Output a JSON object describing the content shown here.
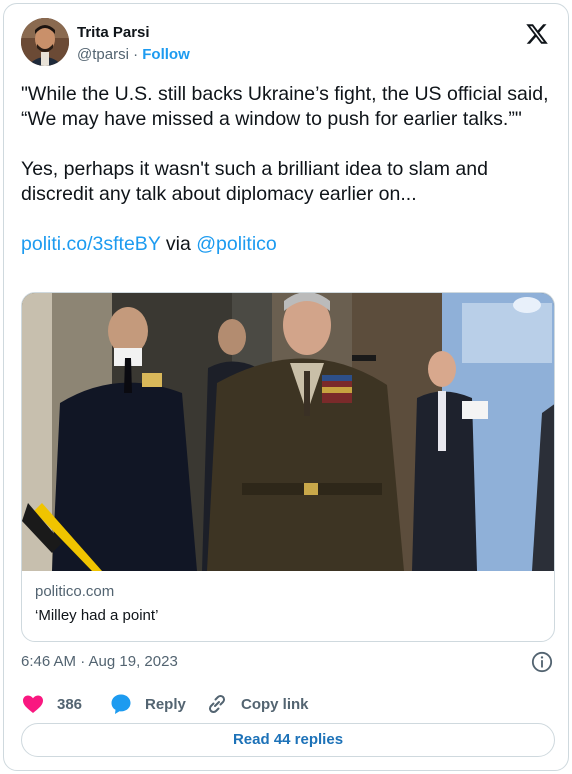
{
  "author": {
    "name": "Trita Parsi",
    "handle": "@tparsi",
    "separator": "·",
    "follow_label": "Follow"
  },
  "brand_icon": "x-logo-icon",
  "tweet": {
    "paragraph_1": "\"While the U.S. still backs Ukraine’s fight, the US official said, “We may have missed a window to push for earlier talks.”\"",
    "paragraph_2": "Yes, perhaps it wasn't such a brilliant idea to slam and discredit any talk about diplomacy earlier on...",
    "link_text": "politi.co/3sfteBY",
    "via_text": "via",
    "mention": "@politico"
  },
  "link_card": {
    "domain": "politico.com",
    "title": "‘Milley had a point’"
  },
  "timestamp": "6:46 AM · Aug 19, 2023",
  "actions": {
    "likes_count": "386",
    "reply_label": "Reply",
    "copy_link_label": "Copy link"
  },
  "read_replies_label": "Read 44 replies",
  "colors": {
    "accent": "#1d9bf0",
    "like": "#f91880",
    "muted": "#536471"
  }
}
